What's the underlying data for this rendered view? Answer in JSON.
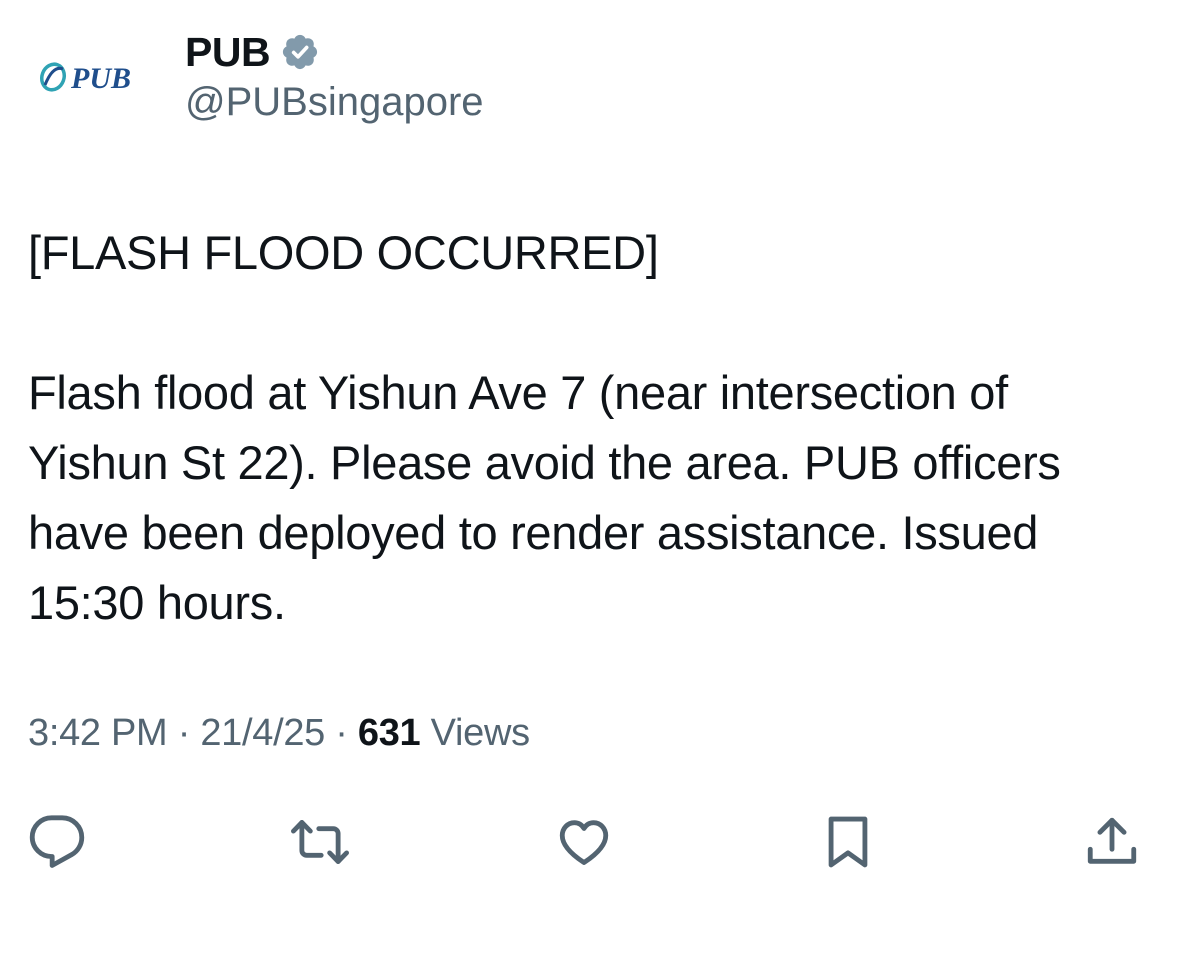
{
  "author": {
    "avatar_text": "PUB",
    "display_name": "PUB",
    "handle": "@PUBsingapore",
    "verified": true,
    "verified_color": "#829aab"
  },
  "tweet": {
    "headline": "[FLASH FLOOD OCCURRED]",
    "body": "Flash flood at Yishun Ave 7 (near intersection of Yishun St 22). Please avoid the area. PUB officers have been deployed to render assistance. Issued 15:30 hours."
  },
  "meta": {
    "time": "3:42 PM",
    "separator": "·",
    "date": "21/4/25",
    "views_count": "631",
    "views_label": "Views"
  },
  "actions": {
    "icons": [
      "reply-icon",
      "retweet-icon",
      "like-icon",
      "bookmark-icon",
      "share-icon"
    ]
  },
  "colors": {
    "text_primary": "#0f1419",
    "text_secondary": "#536471",
    "logo_blue": "#1f4e8c",
    "logo_teal": "#2fa3b4"
  }
}
